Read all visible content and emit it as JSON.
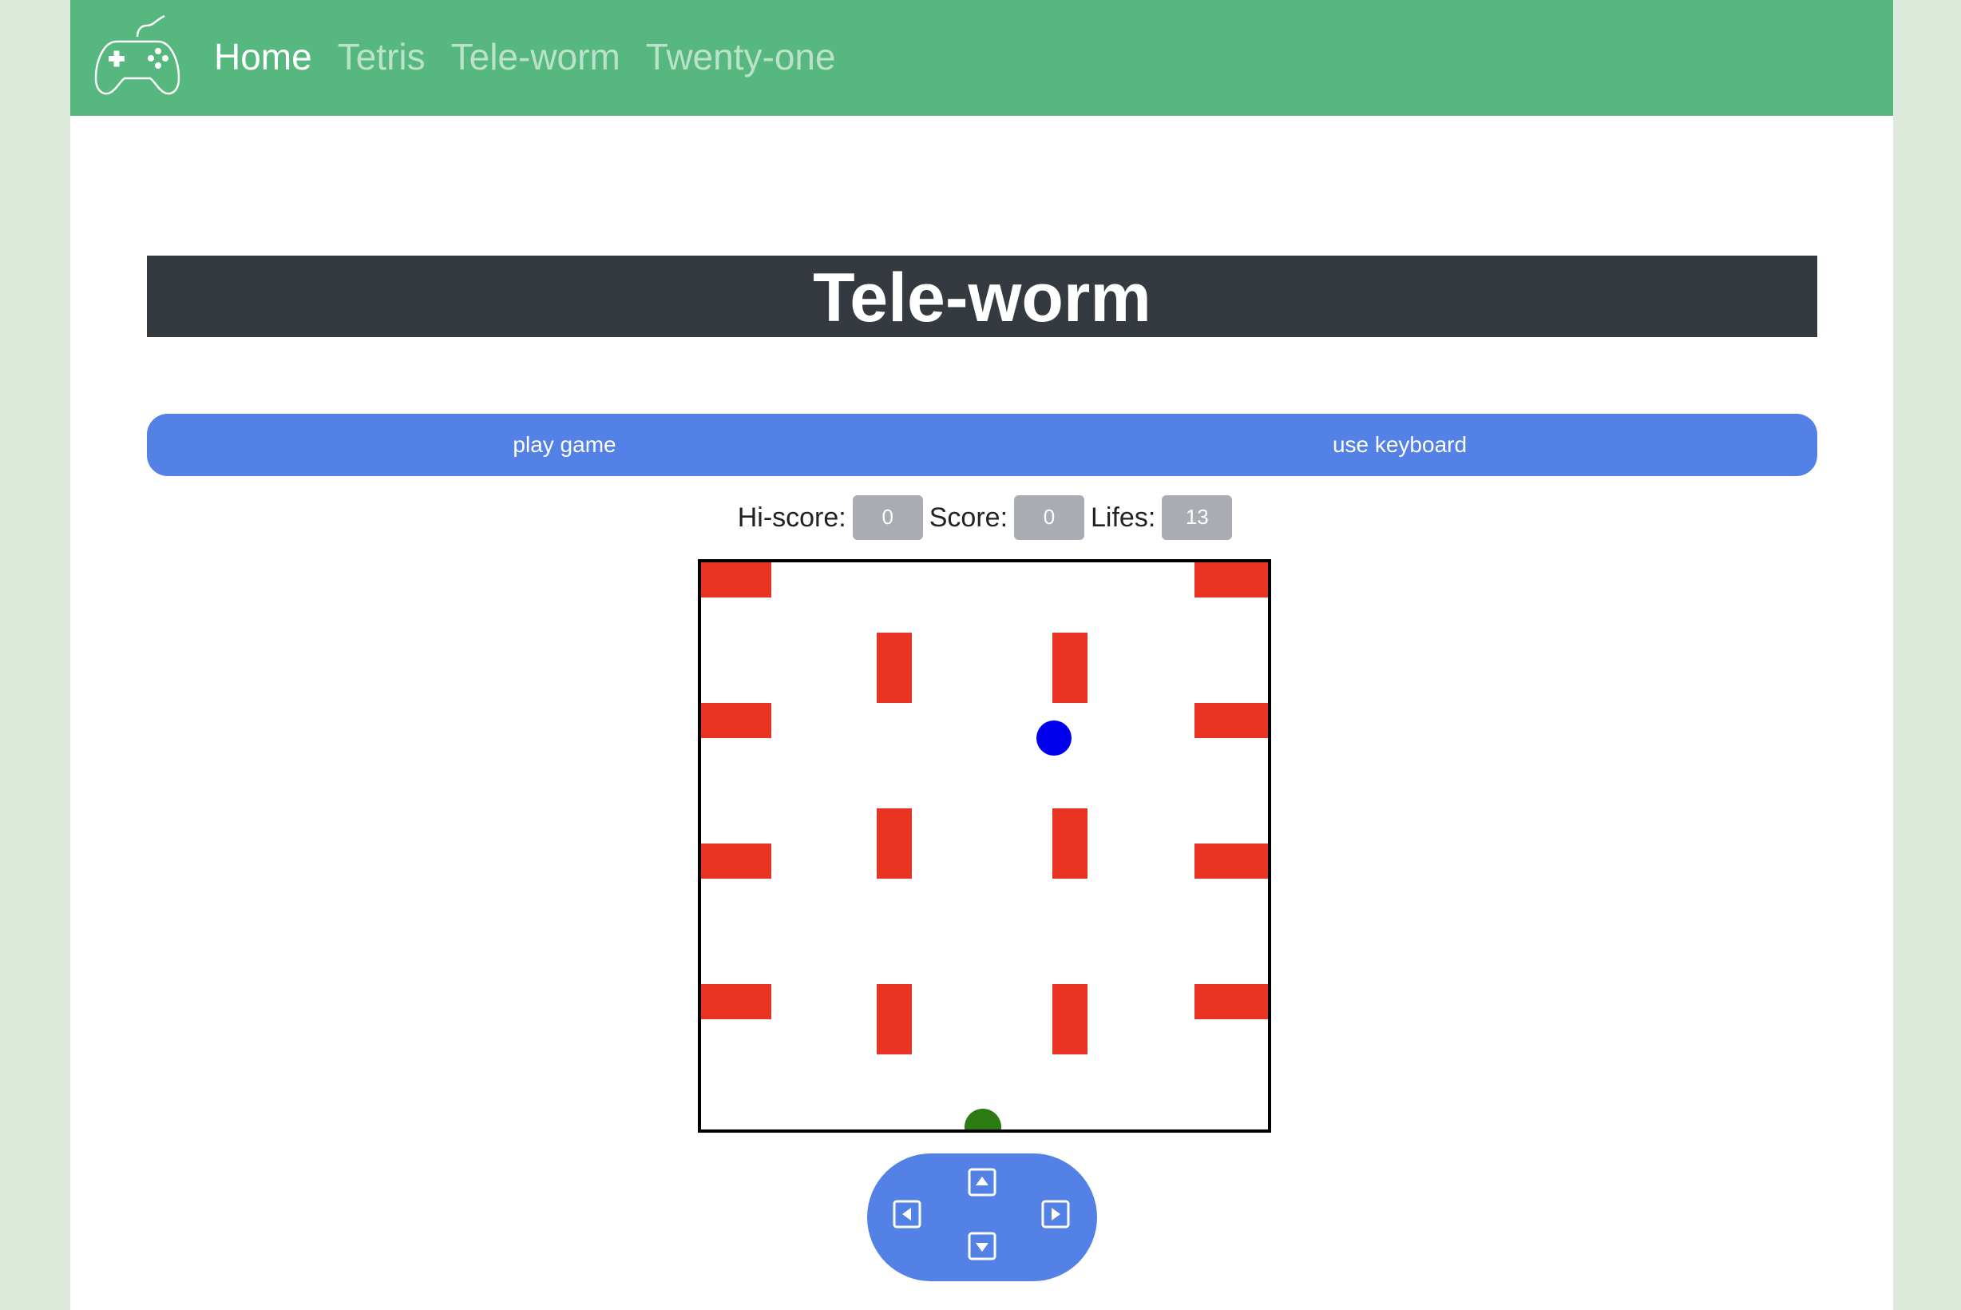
{
  "nav": {
    "logo_icon": "gamepad-icon",
    "links": [
      {
        "label": "Home",
        "active": true
      },
      {
        "label": "Tetris",
        "active": false
      },
      {
        "label": "Tele-worm",
        "active": false
      },
      {
        "label": "Twenty-one",
        "active": false
      }
    ]
  },
  "title": "Tele-worm",
  "buttons": {
    "play_label": "play game",
    "keyboard_label": "use keyboard"
  },
  "stats": {
    "hiscore_label": "Hi-score:",
    "hiscore_value": "0",
    "score_label": "Score:",
    "score_value": "0",
    "lifes_label": "Lifes:",
    "lifes_value": "13"
  },
  "colors": {
    "navbar": "#56b87e",
    "title_bar": "#343a40",
    "button": "#5381e6",
    "wall": "#e93424",
    "apple": "#0000ee",
    "worm": "#2b7a12"
  },
  "controls": {
    "up_icon": "arrow-up-icon",
    "down_icon": "arrow-down-icon",
    "left_icon": "arrow-left-icon",
    "right_icon": "arrow-right-icon"
  }
}
